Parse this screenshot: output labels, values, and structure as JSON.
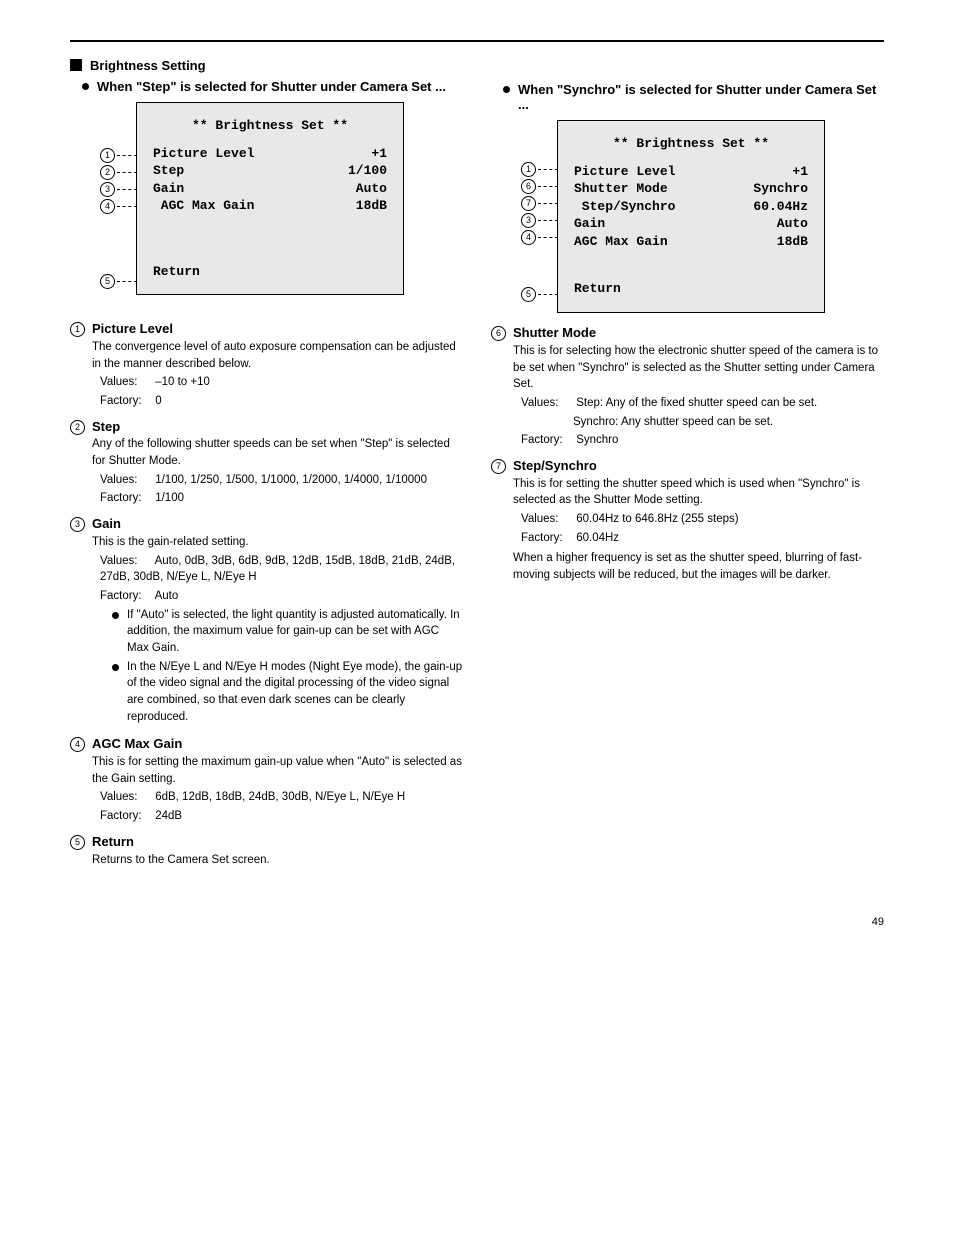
{
  "section_title": "Brightness Setting",
  "left": {
    "sub": "When \"Step\" is selected for Shutter under Camera Set ...",
    "osd_title": "** Brightness Set **",
    "rows": [
      {
        "n": "1",
        "label": "Picture Level",
        "value": "+1"
      },
      {
        "n": "2",
        "label": "Step",
        "value": "1/100"
      },
      {
        "n": "3",
        "label": "Gain",
        "value": "Auto"
      },
      {
        "n": "4",
        "label": " AGC Max Gain",
        "value": "18dB"
      }
    ],
    "return_n": "5",
    "return_label": "Return"
  },
  "right": {
    "sub": "When \"Synchro\" is selected for Shutter under Camera Set ...",
    "osd_title": "** Brightness Set **",
    "rows": [
      {
        "n": "1",
        "label": "Picture Level",
        "value": "+1"
      },
      {
        "n": "6",
        "label": "Shutter Mode",
        "value": "Synchro"
      },
      {
        "n": "7",
        "label": " Step/Synchro",
        "value": "60.04Hz"
      },
      {
        "n": "3",
        "label": "Gain",
        "value": "Auto"
      },
      {
        "n": "4",
        "label": "AGC Max Gain",
        "value": "18dB"
      }
    ],
    "return_n": "5",
    "return_label": "Return"
  },
  "items_left": {
    "i1": {
      "title": "Picture Level",
      "desc": "The convergence level of auto exposure compensation can be adjusted in the manner described below.",
      "values_line1_label": "Values:",
      "values_line1": "–10 to +10",
      "values_line2_label": "Factory:",
      "values_line2": "0"
    },
    "i2": {
      "title": "Step",
      "desc": "Any of the following shutter speeds can be set when \"Step\" is selected for Shutter Mode.",
      "values_line1_label": "Values:",
      "values_line1": "1/100, 1/250, 1/500, 1/1000, 1/2000, 1/4000, 1/10000",
      "values_line2_label": "Factory:",
      "values_line2": "1/100"
    },
    "i3": {
      "title": "Gain",
      "desc": "This is the gain-related setting.",
      "values_line1_label": "Values:",
      "values_line1": "Auto, 0dB, 3dB, 6dB, 9dB, 12dB, 15dB, 18dB, 21dB, 24dB, 27dB, 30dB, N/Eye L, N/Eye H",
      "values_line2_label": "Factory:",
      "values_line2": "Auto",
      "b1": "If \"Auto\" is selected, the light quantity is adjusted automatically. In addition, the maximum value for gain-up can be set with AGC Max Gain.",
      "b2": "In the N/Eye L and N/Eye H modes (Night Eye mode), the gain-up of the video signal and the digital processing of the video signal are combined, so that even dark scenes can be clearly reproduced."
    },
    "i4": {
      "title": "AGC Max Gain",
      "desc": "This is for setting the maximum gain-up value when \"Auto\" is selected as the Gain setting.",
      "values_line1_label": "Values:",
      "values_line1": "6dB, 12dB, 18dB, 24dB, 30dB, N/Eye L, N/Eye H",
      "values_line2_label": "Factory:",
      "values_line2": "24dB"
    },
    "i5": {
      "title": "Return",
      "desc": "Returns to the Camera Set screen."
    }
  },
  "items_right": {
    "i6": {
      "title": "Shutter Mode",
      "desc": "This is for selecting how the electronic shutter speed of the camera is to be set when \"Synchro\" is selected as the Shutter setting under Camera Set.",
      "values_line1_label": "Values:",
      "values_line1": "Step: Any of the fixed shutter speed can be set.",
      "values_line2": "Synchro: Any shutter speed can be set.",
      "values_line3_label": "Factory:",
      "values_line3": "Synchro"
    },
    "i7": {
      "title": "Step/Synchro",
      "desc": "This is for setting the shutter speed which is used when \"Synchro\" is selected as the Shutter Mode setting.",
      "values_line1_label": "Values:",
      "values_line1": "60.04Hz to 646.8Hz (255 steps)",
      "values_line2_label": "Factory:",
      "values_line2": "60.04Hz",
      "note": "When a higher frequency is set as the shutter speed, blurring of fast-moving subjects will be reduced, but the images will be darker."
    }
  },
  "page_number": "49"
}
